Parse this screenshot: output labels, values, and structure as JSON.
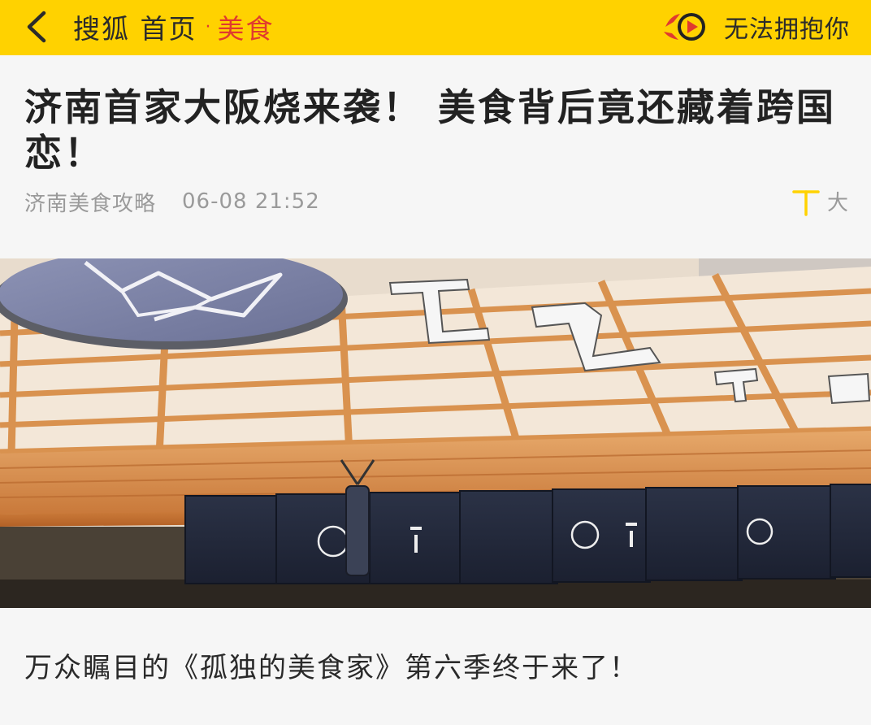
{
  "topbar": {
    "back_icon": "chevron-left-icon",
    "site_name": "搜狐 首页",
    "separator": "·",
    "channel": "美食",
    "audio_icon": "play-circle-icon",
    "audio_label": "无法拥抱你",
    "bg_color": "#ffd200",
    "accent_color": "#e03a2f"
  },
  "article": {
    "title": "济南首家大阪烧来袭！ 美食背后竟还藏着跨国恋！",
    "author": "济南美食攻略",
    "time": "06-08 21:52",
    "font_size_icon": "text-size-icon",
    "font_size_label": "大",
    "hero_image": "restaurant-storefront-photo",
    "first_paragraph": "万众瞩目的《孤独的美食家》第六季终于来了！"
  }
}
